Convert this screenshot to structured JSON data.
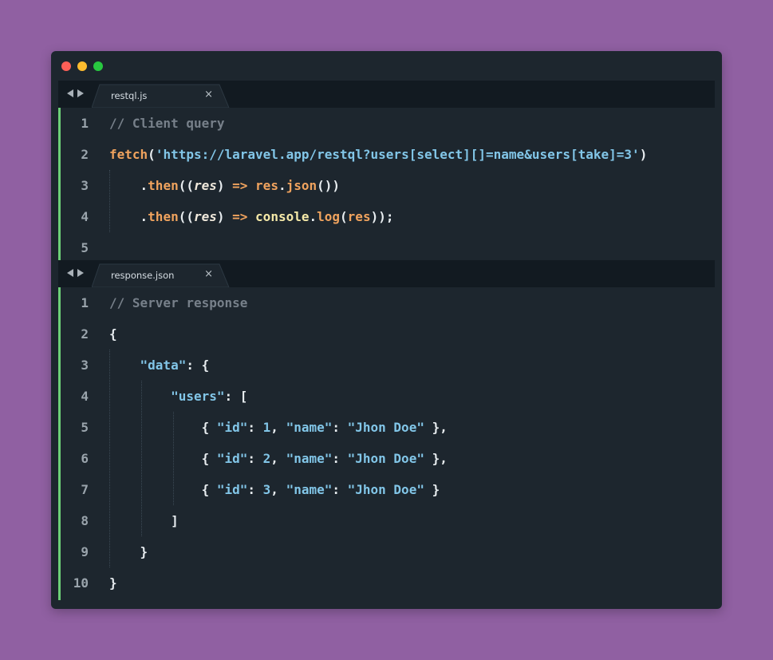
{
  "colors": {
    "background": "#9060a2",
    "editor_bg": "#1d262e",
    "tabbar_bg": "#121a21",
    "gutter_accent": "#6ccf77",
    "comment": "#77808a",
    "function": "#f0a35e",
    "string": "#82c6e8"
  },
  "window": {
    "controls": [
      "close-dot",
      "minimize-dot",
      "maximize-dot"
    ]
  },
  "panes": [
    {
      "tab": {
        "label": "restql.js",
        "close": "×"
      },
      "lines": [
        {
          "n": "1",
          "tokens": [
            {
              "t": "// Client query",
              "c": "comment"
            }
          ]
        },
        {
          "n": "2",
          "tokens": [
            {
              "t": "fetch",
              "c": "fn"
            },
            {
              "t": "(",
              "c": "punct"
            },
            {
              "t": "'https://laravel.app/restql?users[select][]=name&users[take]=3'",
              "c": "str"
            },
            {
              "t": ")",
              "c": "punct"
            }
          ]
        },
        {
          "n": "3",
          "tokens": [
            {
              "t": "    .",
              "c": "punct"
            },
            {
              "t": "then",
              "c": "fn"
            },
            {
              "t": "((",
              "c": "punct"
            },
            {
              "t": "res",
              "c": "param"
            },
            {
              "t": ") ",
              "c": "punct"
            },
            {
              "t": "=>",
              "c": "fn"
            },
            {
              "t": " ",
              "c": "punct"
            },
            {
              "t": "res",
              "c": "fn"
            },
            {
              "t": ".",
              "c": "punct"
            },
            {
              "t": "json",
              "c": "fn"
            },
            {
              "t": "())",
              "c": "punct"
            }
          ]
        },
        {
          "n": "4",
          "tokens": [
            {
              "t": "    .",
              "c": "punct"
            },
            {
              "t": "then",
              "c": "fn"
            },
            {
              "t": "((",
              "c": "punct"
            },
            {
              "t": "res",
              "c": "param"
            },
            {
              "t": ") ",
              "c": "punct"
            },
            {
              "t": "=>",
              "c": "fn"
            },
            {
              "t": " ",
              "c": "punct"
            },
            {
              "t": "console",
              "c": "yel"
            },
            {
              "t": ".",
              "c": "punct"
            },
            {
              "t": "log",
              "c": "fn"
            },
            {
              "t": "(",
              "c": "punct"
            },
            {
              "t": "res",
              "c": "fn"
            },
            {
              "t": "));",
              "c": "punct"
            }
          ]
        },
        {
          "n": "5",
          "tokens": []
        }
      ]
    },
    {
      "tab": {
        "label": "response.json",
        "close": "×"
      },
      "lines": [
        {
          "n": "1",
          "tokens": [
            {
              "t": "// Server response",
              "c": "comment"
            }
          ]
        },
        {
          "n": "2",
          "tokens": [
            {
              "t": "{",
              "c": "punct"
            }
          ]
        },
        {
          "n": "3",
          "tokens": [
            {
              "t": "    ",
              "c": "punct"
            },
            {
              "t": "\"data\"",
              "c": "str"
            },
            {
              "t": ": {",
              "c": "punct"
            }
          ]
        },
        {
          "n": "4",
          "tokens": [
            {
              "t": "        ",
              "c": "punct"
            },
            {
              "t": "\"users\"",
              "c": "str"
            },
            {
              "t": ": [",
              "c": "punct"
            }
          ]
        },
        {
          "n": "5",
          "tokens": [
            {
              "t": "            { ",
              "c": "punct"
            },
            {
              "t": "\"id\"",
              "c": "str"
            },
            {
              "t": ": ",
              "c": "punct"
            },
            {
              "t": "1",
              "c": "num"
            },
            {
              "t": ", ",
              "c": "punct"
            },
            {
              "t": "\"name\"",
              "c": "str"
            },
            {
              "t": ": ",
              "c": "punct"
            },
            {
              "t": "\"Jhon Doe\"",
              "c": "str"
            },
            {
              "t": " },",
              "c": "punct"
            }
          ]
        },
        {
          "n": "6",
          "tokens": [
            {
              "t": "            { ",
              "c": "punct"
            },
            {
              "t": "\"id\"",
              "c": "str"
            },
            {
              "t": ": ",
              "c": "punct"
            },
            {
              "t": "2",
              "c": "num"
            },
            {
              "t": ", ",
              "c": "punct"
            },
            {
              "t": "\"name\"",
              "c": "str"
            },
            {
              "t": ": ",
              "c": "punct"
            },
            {
              "t": "\"Jhon Doe\"",
              "c": "str"
            },
            {
              "t": " },",
              "c": "punct"
            }
          ]
        },
        {
          "n": "7",
          "tokens": [
            {
              "t": "            { ",
              "c": "punct"
            },
            {
              "t": "\"id\"",
              "c": "str"
            },
            {
              "t": ": ",
              "c": "punct"
            },
            {
              "t": "3",
              "c": "num"
            },
            {
              "t": ", ",
              "c": "punct"
            },
            {
              "t": "\"name\"",
              "c": "str"
            },
            {
              "t": ": ",
              "c": "punct"
            },
            {
              "t": "\"Jhon Doe\"",
              "c": "str"
            },
            {
              "t": " }",
              "c": "punct"
            }
          ]
        },
        {
          "n": "8",
          "tokens": [
            {
              "t": "        ]",
              "c": "punct"
            }
          ]
        },
        {
          "n": "9",
          "tokens": [
            {
              "t": "    }",
              "c": "punct"
            }
          ]
        },
        {
          "n": "10",
          "tokens": [
            {
              "t": "}",
              "c": "punct"
            }
          ]
        }
      ]
    }
  ]
}
